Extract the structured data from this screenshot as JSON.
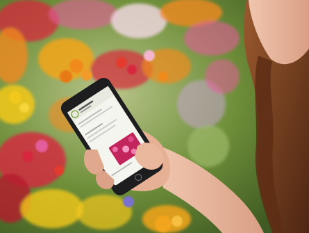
{
  "photo": {
    "subject": "person-holding-smartphone",
    "setting": "flower-garden-center",
    "palette": {
      "background_green": "#6f8f3a",
      "flower_orange": "#f08a1e",
      "flower_red": "#d7263d",
      "flower_pink": "#e35d9a",
      "flower_yellow": "#f2c81b",
      "hair_brown": "#7a3f1e",
      "skin": "#e8b9a0",
      "phone_black": "#1d1d1f",
      "screen_white": "#f5f5f0",
      "app_green": "#7fa84a"
    }
  },
  "phone_screen": {
    "icons": [
      "logo-icon",
      "flowers-thumbnail",
      "home-icon"
    ]
  }
}
